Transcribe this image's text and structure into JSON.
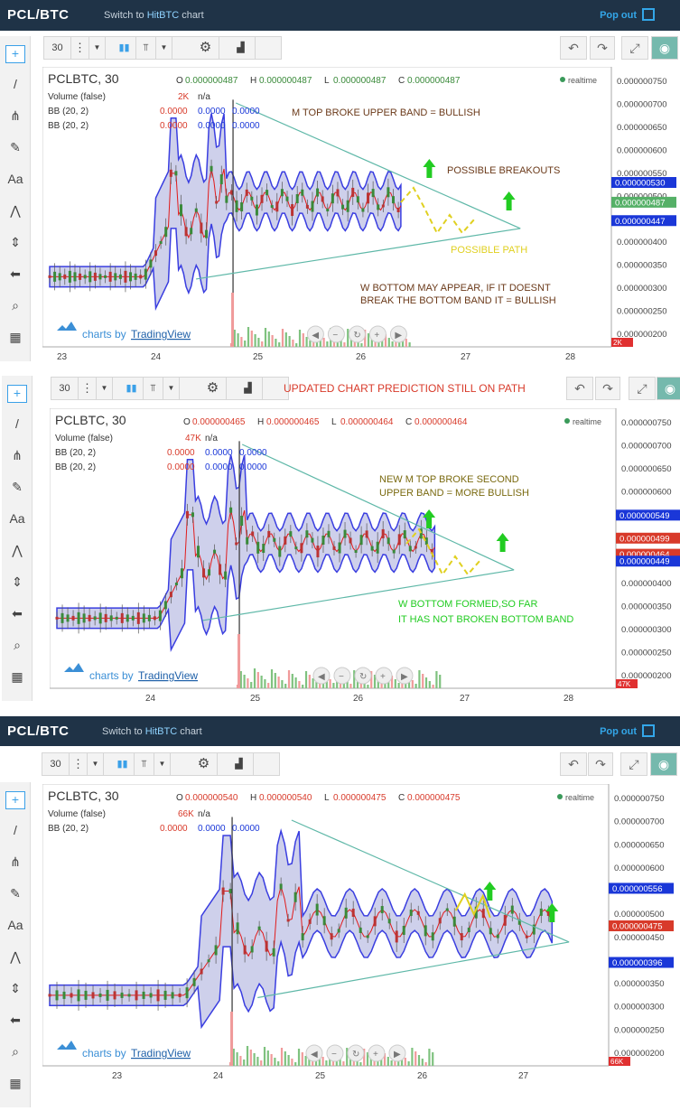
{
  "header": {
    "title": "PCL/BTC",
    "switch_pre": "Switch to ",
    "switch_link": "HitBTC",
    "switch_post": " chart",
    "popout": "Pop out"
  },
  "toolbar": {
    "interval": "30"
  },
  "colors": {
    "band_fill": "#c5c8e8",
    "band_line": "#3a3ee0",
    "mid_line": "#e01b1b",
    "up": "#3a8a3a",
    "down": "#b33",
    "tri": "#5fb8a8",
    "anno_green": "#22cc22",
    "anno_yellow": "#e0d020"
  },
  "panels": [
    {
      "symbol": "PCLBTC, 30",
      "ohlc": {
        "o_label": "O",
        "o": "0.000000487",
        "h_label": "H",
        "h": "0.000000487",
        "l_label": "L",
        "l": "0.000000487",
        "c_label": "C",
        "c": "0.000000487"
      },
      "realtime": "realtime",
      "volume_label": "Volume (false)",
      "volume_value": "2K",
      "volume_na": "n/a",
      "bb": [
        {
          "label": "BB (20, 2)",
          "v1": "0.0000",
          "v2": "0.0000",
          "v3": "0.0000"
        },
        {
          "label": "BB (20, 2)",
          "v1": "0.0000",
          "v2": "0.0000",
          "v3": "0.0000"
        }
      ],
      "price_axis": [
        "0.000000750",
        "0.000000700",
        "0.000000650",
        "0.000000600",
        "0.000000550",
        "0.000000500",
        "0.000000450",
        "0.000000400",
        "0.000000350",
        "0.000000300",
        "0.000000250",
        "0.000000200"
      ],
      "price_tags": [
        {
          "value": "0.000000530",
          "color": "#1a37d8"
        },
        {
          "value": "0.000000487",
          "color": "#55b067"
        },
        {
          "value": "0.000000447",
          "color": "#1a37d8"
        }
      ],
      "vol_tag": "2K",
      "x_labels": [
        "23",
        "24",
        "25",
        "26",
        "27",
        "28"
      ],
      "watermark": {
        "pre": "charts by ",
        "brand": "TradingView"
      },
      "annotations": [
        {
          "text": "M TOP BROKE UPPER BAND = BULLISH",
          "color": "#6b3a1a"
        },
        {
          "text": "POSSIBLE BREAKOUTS",
          "color": "#6b3a1a"
        },
        {
          "text": "POSSIBLE PATH",
          "color": "#e0d020"
        },
        {
          "text": "W BOTTOM MAY APPEAR, IF IT DOESNT",
          "color": "#6b3a1a"
        },
        {
          "text": "BREAK THE BOTTOM BAND IT = BULLISH",
          "color": "#6b3a1a"
        }
      ]
    },
    {
      "symbol": "PCLBTC, 30",
      "ohlc": {
        "o_label": "O",
        "o": "0.000000465",
        "h_label": "H",
        "h": "0.000000465",
        "l_label": "L",
        "l": "0.000000464",
        "c_label": "C",
        "c": "0.000000464"
      },
      "realtime": "realtime",
      "volume_label": "Volume (false)",
      "volume_value": "47K",
      "volume_na": "n/a",
      "bb": [
        {
          "label": "BB (20, 2)",
          "v1": "0.0000",
          "v2": "0.0000",
          "v3": "0.0000"
        },
        {
          "label": "BB (20, 2)",
          "v1": "0.0000",
          "v2": "0.0000",
          "v3": "0.0000"
        }
      ],
      "title_note": "UPDATED CHART PREDICTION STILL ON PATH",
      "price_axis": [
        "0.000000750",
        "0.000000700",
        "0.000000650",
        "0.000000600",
        "0.000000550",
        "0.000000500",
        "0.000000450",
        "0.000000400",
        "0.000000350",
        "0.000000300",
        "0.000000250",
        "0.000000200"
      ],
      "price_tags": [
        {
          "value": "0.000000549",
          "color": "#1a37d8"
        },
        {
          "value": "0.000000499",
          "color": "#d83a2a"
        },
        {
          "value": "0.000000464",
          "color": "#d83a2a"
        },
        {
          "value": "0.000000449",
          "color": "#1a37d8"
        }
      ],
      "vol_tag": "47K",
      "x_labels": [
        "24",
        "25",
        "26",
        "27",
        "28"
      ],
      "watermark": {
        "pre": "charts by ",
        "brand": "TradingView"
      },
      "annotations": [
        {
          "text": "NEW M TOP BROKE SECOND",
          "color": "#7a6a10"
        },
        {
          "text": "UPPER BAND = MORE BULLISH",
          "color": "#7a6a10"
        },
        {
          "text": "W BOTTOM  FORMED,SO FAR",
          "color": "#22cc22"
        },
        {
          "text": "IT HAS NOT BROKEN BOTTOM BAND",
          "color": "#22cc22"
        }
      ]
    },
    {
      "symbol": "PCLBTC, 30",
      "ohlc": {
        "o_label": "O",
        "o": "0.000000540",
        "h_label": "H",
        "h": "0.000000540",
        "l_label": "L",
        "l": "0.000000475",
        "c_label": "C",
        "c": "0.000000475"
      },
      "realtime": "realtime",
      "volume_label": "Volume (false)",
      "volume_value": "66K",
      "volume_na": "n/a",
      "bb": [
        {
          "label": "BB (20, 2)",
          "v1": "0.0000",
          "v2": "0.0000",
          "v3": "0.0000"
        }
      ],
      "price_axis": [
        "0.000000750",
        "0.000000700",
        "0.000000650",
        "0.000000600",
        "0.000000550",
        "0.000000500",
        "0.000000450",
        "0.000000400",
        "0.000000350",
        "0.000000300",
        "0.000000250",
        "0.000000200"
      ],
      "price_tags": [
        {
          "value": "0.000000556",
          "color": "#1a37d8"
        },
        {
          "value": "0.000000475",
          "color": "#d83a2a"
        },
        {
          "value": "0.000000396",
          "color": "#1a37d8"
        }
      ],
      "vol_tag": "66K",
      "x_labels": [
        "23",
        "24",
        "25",
        "26",
        "27"
      ],
      "watermark": {
        "pre": "charts by ",
        "brand": "TradingView"
      },
      "annotations": []
    }
  ],
  "chart_data": [
    {
      "type": "line",
      "title": "PCLBTC, 30 — Bollinger Bands (20, 2)",
      "x": [
        "23",
        "24",
        "25",
        "26",
        "27",
        "28"
      ],
      "ylim": [
        2e-07,
        7.5e-07
      ],
      "last": 4.87e-07,
      "upper": 5.3e-07,
      "lower": 4.47e-07
    },
    {
      "type": "line",
      "title": "PCLBTC, 30 — Bollinger Bands (20, 2)",
      "x": [
        "24",
        "25",
        "26",
        "27",
        "28"
      ],
      "ylim": [
        2e-07,
        7.5e-07
      ],
      "last": 4.64e-07,
      "upper": 5.49e-07,
      "lower": 4.49e-07
    },
    {
      "type": "line",
      "title": "PCLBTC, 30 — Bollinger Bands (20, 2)",
      "x": [
        "23",
        "24",
        "25",
        "26",
        "27"
      ],
      "ylim": [
        2e-07,
        7.5e-07
      ],
      "last": 4.75e-07,
      "upper": 5.56e-07,
      "lower": 3.96e-07
    }
  ]
}
